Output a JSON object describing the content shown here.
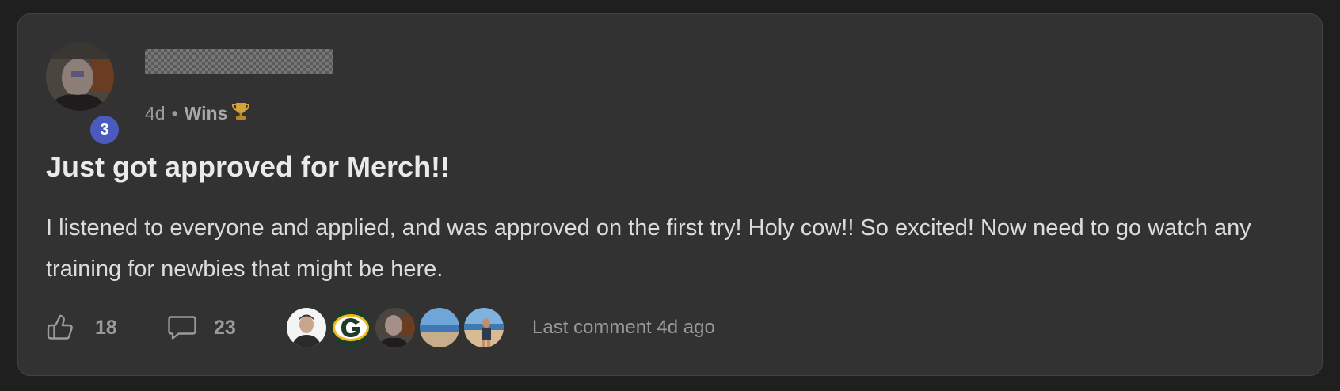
{
  "post": {
    "author": {
      "name": "",
      "level": "3"
    },
    "time_ago": "4d",
    "separator": "•",
    "category": "Wins",
    "category_icon": "trophy-icon",
    "title": "Just got approved for Merch!!",
    "body": "I listened to everyone and applied, and was approved on the first try! Holy cow!! So excited! Now need to go watch any training for newbies that might be here.",
    "likes": "18",
    "comments": "23",
    "last_comment": "Last comment 4d ago"
  },
  "colors": {
    "page_bg": "#1f1f1f",
    "card_bg": "#323232",
    "badge_bg": "#4a5bbd",
    "text_primary": "#eaeaea",
    "text_muted": "#9a9a9a",
    "trophy": "#d4a23a"
  },
  "icons": {
    "like": "thumbs-up-icon",
    "comment": "speech-bubble-icon"
  }
}
